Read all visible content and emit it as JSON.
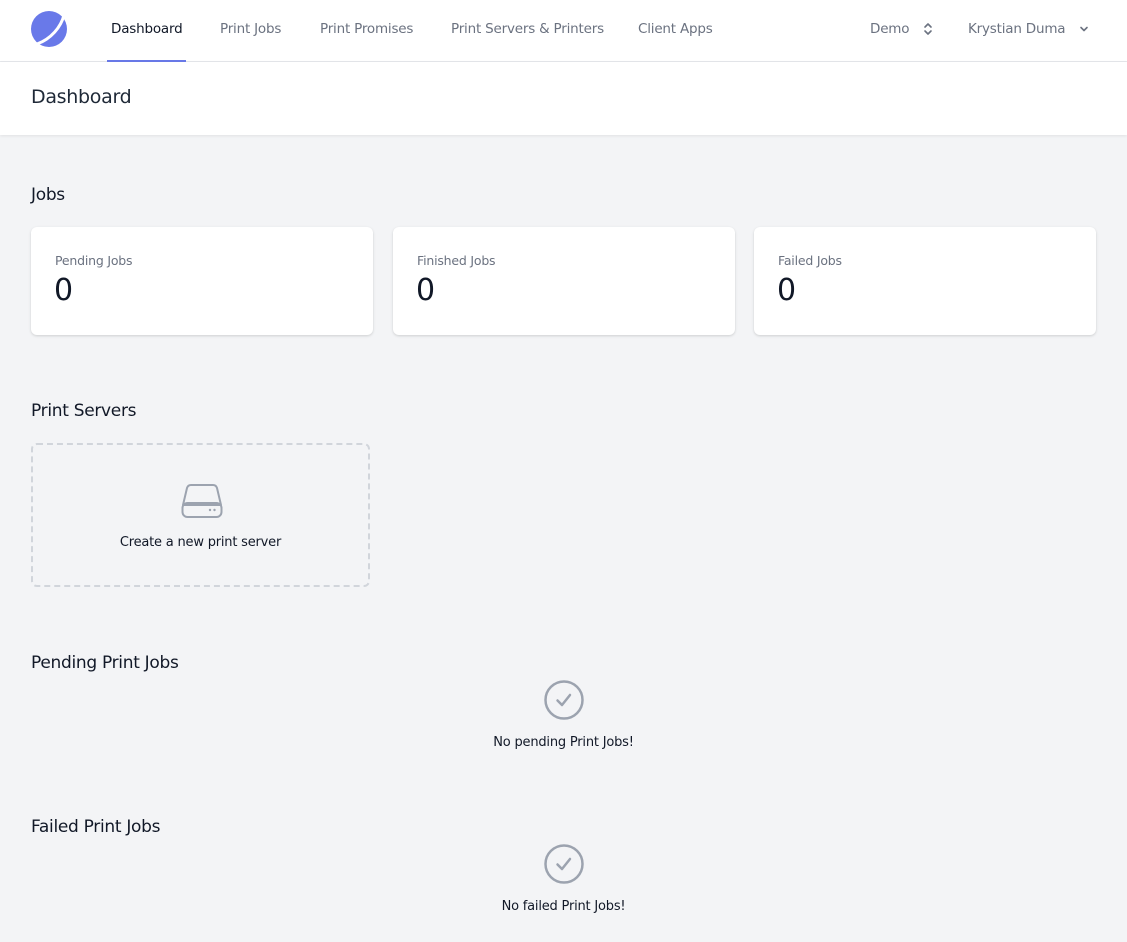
{
  "nav": {
    "logo": "logo-icon",
    "items": [
      {
        "label": "Dashboard",
        "active": true
      },
      {
        "label": "Print Jobs",
        "active": false
      },
      {
        "label": "Print Promises",
        "active": false
      },
      {
        "label": "Print Servers & Printers",
        "active": false
      },
      {
        "label": "Client Apps",
        "active": false
      }
    ],
    "org_selector": {
      "label": "Demo",
      "icon": "selector-icon"
    },
    "user_menu": {
      "label": "Krystian Duma",
      "icon": "chevron-down-icon"
    },
    "accent_color": "#6979e9"
  },
  "header": {
    "title": "Dashboard"
  },
  "jobs": {
    "title": "Jobs",
    "stats": [
      {
        "label": "Pending Jobs",
        "value": "0"
      },
      {
        "label": "Finished Jobs",
        "value": "0"
      },
      {
        "label": "Failed Jobs",
        "value": "0"
      }
    ]
  },
  "print_servers": {
    "title": "Print Servers",
    "create_label": "Create a new print server",
    "icon": "server-icon"
  },
  "pending_print_jobs": {
    "title": "Pending Print Jobs",
    "empty_text": "No pending Print Jobs!",
    "icon": "check-circle-icon"
  },
  "failed_print_jobs": {
    "title": "Failed Print Jobs",
    "empty_text": "No failed Print Jobs!",
    "icon": "check-circle-icon"
  }
}
